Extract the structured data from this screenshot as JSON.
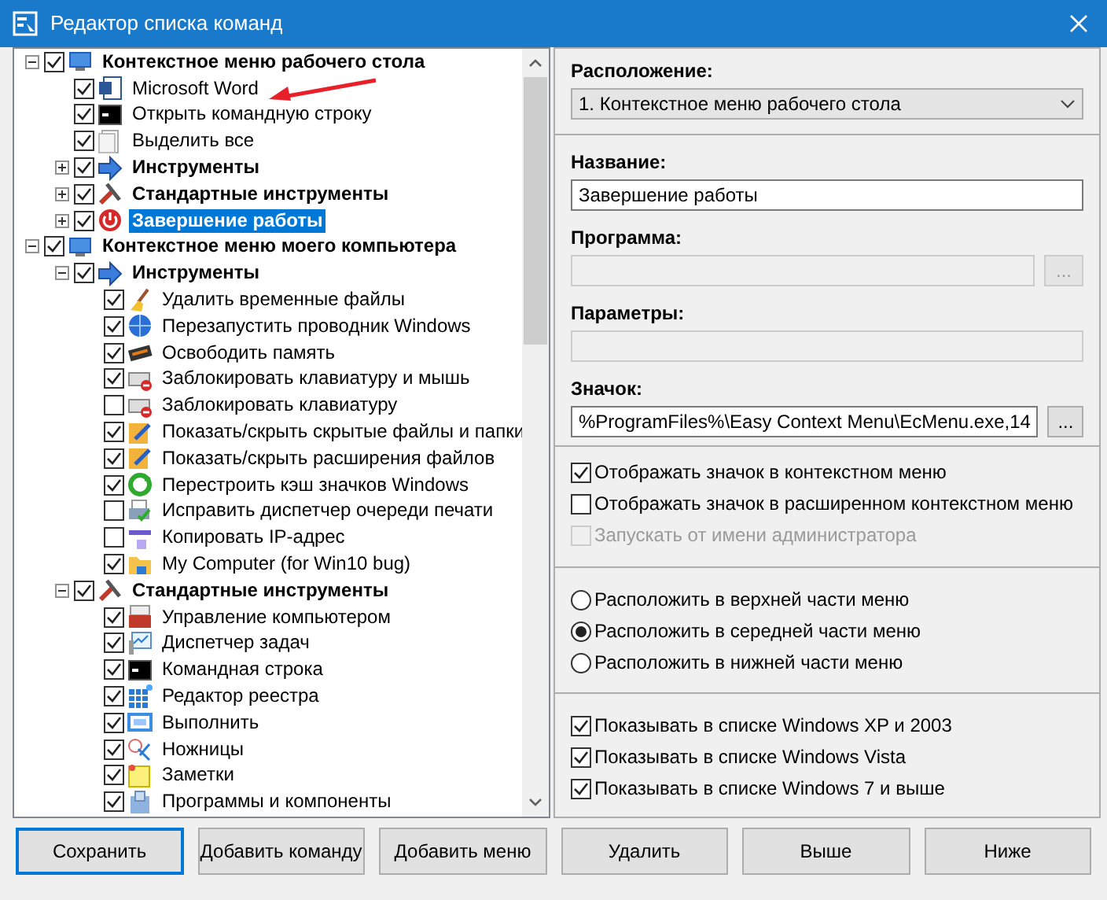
{
  "window": {
    "title": "Редактор списка команд"
  },
  "tree": [
    {
      "kind": "group",
      "label": "Контекстное меню рабочего стола",
      "checked": true,
      "expanded": true,
      "selected": false,
      "children": [
        {
          "kind": "command",
          "label": "Microsoft Word",
          "checked": true,
          "selected": false
        },
        {
          "kind": "command",
          "label": "Открыть командную строку",
          "checked": true,
          "selected": false
        },
        {
          "kind": "command",
          "label": "Выделить все",
          "checked": true,
          "selected": false
        },
        {
          "kind": "group",
          "label": "Инструменты",
          "checked": true,
          "expanded": false,
          "selected": false
        },
        {
          "kind": "group",
          "label": "Стандартные инструменты",
          "checked": true,
          "expanded": false,
          "selected": false
        },
        {
          "kind": "group",
          "label": "Завершение работы",
          "checked": true,
          "expanded": false,
          "selected": true
        }
      ]
    },
    {
      "kind": "group",
      "label": "Контекстное меню моего компьютера",
      "checked": true,
      "expanded": true,
      "selected": false,
      "children": [
        {
          "kind": "group",
          "label": "Инструменты",
          "checked": true,
          "expanded": true,
          "selected": false,
          "children": [
            {
              "kind": "command",
              "label": "Удалить временные файлы",
              "checked": true,
              "selected": false
            },
            {
              "kind": "command",
              "label": "Перезапустить проводник Windows",
              "checked": true,
              "selected": false
            },
            {
              "kind": "command",
              "label": "Освободить память",
              "checked": true,
              "selected": false
            },
            {
              "kind": "command",
              "label": "Заблокировать клавиатуру и мышь",
              "checked": true,
              "selected": false
            },
            {
              "kind": "command",
              "label": "Заблокировать клавиатуру",
              "checked": false,
              "selected": false
            },
            {
              "kind": "command",
              "label": "Показать/скрыть скрытые файлы и папки",
              "checked": true,
              "selected": false
            },
            {
              "kind": "command",
              "label": "Показать/скрыть расширения файлов",
              "checked": true,
              "selected": false
            },
            {
              "kind": "command",
              "label": "Перестроить кэш значков Windows",
              "checked": true,
              "selected": false
            },
            {
              "kind": "command",
              "label": "Исправить диспетчер очереди печати",
              "checked": false,
              "selected": false
            },
            {
              "kind": "command",
              "label": "Копировать IP-адрес",
              "checked": false,
              "selected": false
            },
            {
              "kind": "command",
              "label": "My Computer (for Win10 bug)",
              "checked": true,
              "selected": false
            }
          ]
        },
        {
          "kind": "group",
          "label": "Стандартные инструменты",
          "checked": true,
          "expanded": true,
          "selected": false,
          "children": [
            {
              "kind": "command",
              "label": "Управление компьютером",
              "checked": true,
              "selected": false
            },
            {
              "kind": "command",
              "label": "Диспетчер задач",
              "checked": true,
              "selected": false
            },
            {
              "kind": "command",
              "label": "Командная строка",
              "checked": true,
              "selected": false
            },
            {
              "kind": "command",
              "label": "Редактор реестра",
              "checked": true,
              "selected": false
            },
            {
              "kind": "command",
              "label": "Выполнить",
              "checked": true,
              "selected": false
            },
            {
              "kind": "command",
              "label": "Ножницы",
              "checked": true,
              "selected": false
            },
            {
              "kind": "command",
              "label": "Заметки",
              "checked": true,
              "selected": false
            },
            {
              "kind": "command",
              "label": "Программы и компоненты",
              "checked": true,
              "selected": false
            }
          ]
        }
      ]
    }
  ],
  "details": {
    "location": {
      "label": "Расположение:",
      "value": "1. Контекстное меню рабочего стола"
    },
    "fields": [
      {
        "label": "Название:",
        "value": "Завершение работы",
        "disabled": false
      },
      {
        "label": "Программа:",
        "disabled": true,
        "browse": "..."
      },
      {
        "label": "Параметры:",
        "disabled": true
      },
      {
        "label": "Значок:",
        "value": "%ProgramFiles%\\Easy Context Menu\\EcMenu.exe,14",
        "disabled": false,
        "browse": "..."
      }
    ],
    "display_options": [
      {
        "label": "Отображать значок в контекстном меню",
        "checked": true,
        "disabled": false
      },
      {
        "label": "Отображать значок в расширенном контекстном меню",
        "checked": false,
        "disabled": false
      },
      {
        "label": "Запускать от имени администратора",
        "checked": false,
        "disabled": true
      }
    ],
    "position_options": [
      {
        "label": "Расположить в верхней части меню",
        "selected": false
      },
      {
        "label": "Расположить в середней части меню",
        "selected": true
      },
      {
        "label": "Расположить в нижней части меню",
        "selected": false
      }
    ],
    "show_in_lists": [
      {
        "label": "Показывать в списке Windows XP и 2003",
        "checked": true
      },
      {
        "label": "Показывать в списке Windows Vista",
        "checked": true
      },
      {
        "label": "Показывать в списке Windows 7 и выше",
        "checked": true
      }
    ]
  },
  "buttons": [
    {
      "label": "Сохранить",
      "default": true
    },
    {
      "label": "Добавить команду",
      "default": false
    },
    {
      "label": "Добавить меню",
      "default": false
    },
    {
      "label": "Удалить",
      "default": false
    },
    {
      "label": "Выше",
      "default": false
    },
    {
      "label": "Ниже",
      "default": false
    }
  ]
}
